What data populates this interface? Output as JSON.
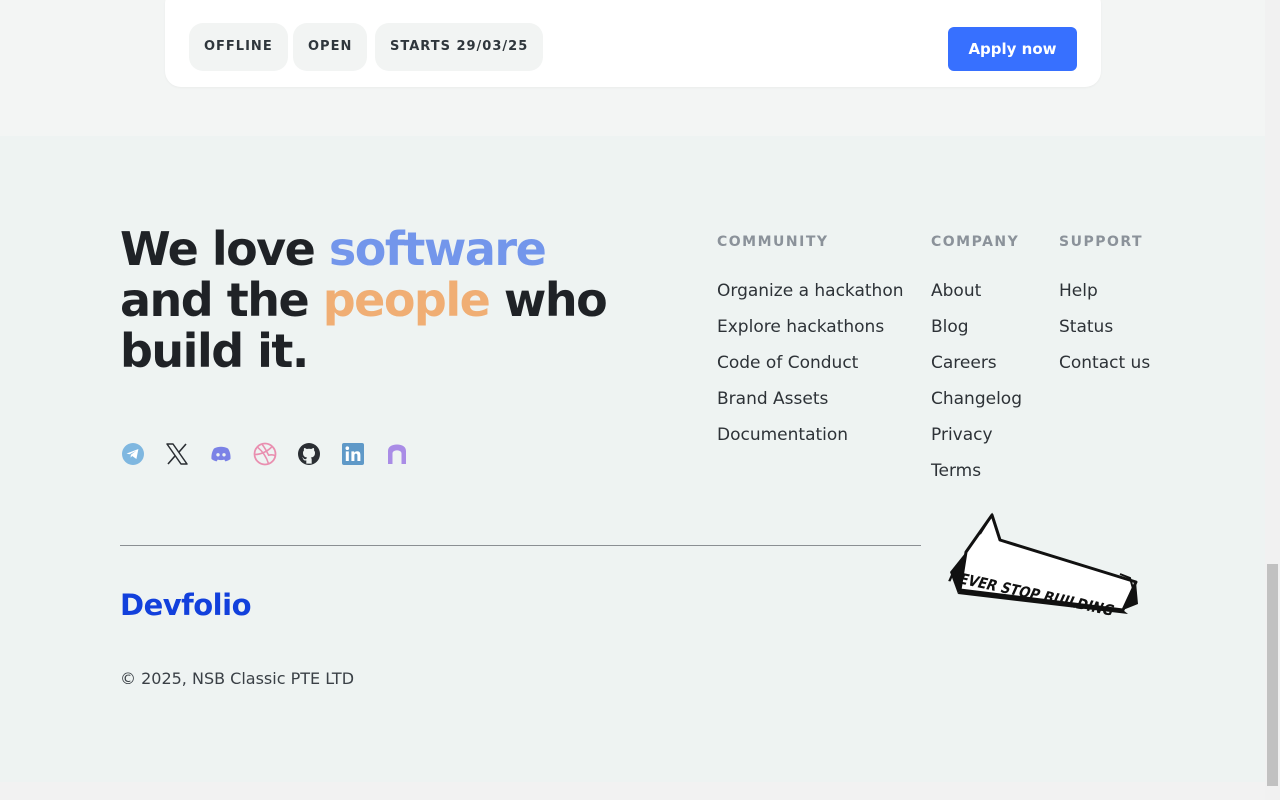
{
  "card": {
    "tags": [
      "OFFLINE",
      "OPEN",
      "STARTS 29/03/25"
    ],
    "apply_label": "Apply now",
    "accent_color": "#3770ff"
  },
  "tagline": {
    "part1": "We love ",
    "highlight1": "software",
    "part2": "and the ",
    "highlight2": "people",
    "part3": " who",
    "part4": "build it."
  },
  "socials": [
    "telegram-icon",
    "x-icon",
    "discord-icon",
    "dribbble-icon",
    "github-icon",
    "linkedin-icon",
    "devfolio-arch-icon"
  ],
  "columns": {
    "community": {
      "title": "COMMUNITY",
      "links": [
        "Organize a hackathon",
        "Explore hackathons",
        "Code of Conduct",
        "Brand Assets",
        "Documentation"
      ]
    },
    "company": {
      "title": "COMPANY",
      "links": [
        "About",
        "Blog",
        "Careers",
        "Changelog",
        "Privacy",
        "Terms"
      ]
    },
    "support": {
      "title": "SUPPORT",
      "links": [
        "Help",
        "Status",
        "Contact us"
      ]
    }
  },
  "logo": "Devfolio",
  "badge_text": "NEVER STOP BUILDING",
  "copyright": "© 2025, NSB Classic PTE LTD"
}
